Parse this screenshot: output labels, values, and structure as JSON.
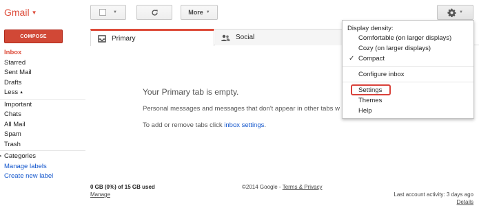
{
  "app": {
    "logo": "Gmail",
    "colors": {
      "brand_red": "#dd4b39",
      "compose_red": "#d14836",
      "link_blue": "#1155cc",
      "highlight_red": "#d9413a"
    }
  },
  "toolbar": {
    "more_label": "More",
    "icons": {
      "select": "checkbox-icon",
      "refresh": "refresh-icon",
      "settings": "gear-icon"
    }
  },
  "sidebar": {
    "compose_label": "COMPOSE",
    "primary_items": [
      "Inbox",
      "Starred",
      "Sent Mail",
      "Drafts"
    ],
    "less_label": "Less",
    "secondary_items": [
      "Important",
      "Chats",
      "All Mail",
      "Spam",
      "Trash"
    ],
    "categories_label": "Categories",
    "links": [
      "Manage labels",
      "Create new label"
    ]
  },
  "tabs": [
    {
      "label": "Primary",
      "icon": "inbox-icon",
      "active": true
    },
    {
      "label": "Social",
      "icon": "people-icon",
      "active": false
    }
  ],
  "main": {
    "empty_title": "Your Primary tab is empty.",
    "empty_desc": "Personal messages and messages that don't appear in other tabs w",
    "tabs_hint_prefix": "To add or remove tabs click ",
    "tabs_hint_link": "inbox settings",
    "tabs_hint_suffix": "."
  },
  "footer": {
    "storage": "0 GB (0%) of 15 GB used",
    "manage": "Manage",
    "copyright": "©2014 Google - ",
    "terms": "Terms & Privacy",
    "activity": "Last account activity: 3 days ago",
    "details": "Details"
  },
  "settings_menu": {
    "density_heading": "Display density:",
    "density_options": [
      {
        "label": "Comfortable (on larger displays)",
        "checked": false
      },
      {
        "label": "Cozy (on larger displays)",
        "checked": false
      },
      {
        "label": "Compact",
        "checked": true
      }
    ],
    "configure_inbox": "Configure inbox",
    "settings": "Settings",
    "themes": "Themes",
    "help": "Help"
  }
}
